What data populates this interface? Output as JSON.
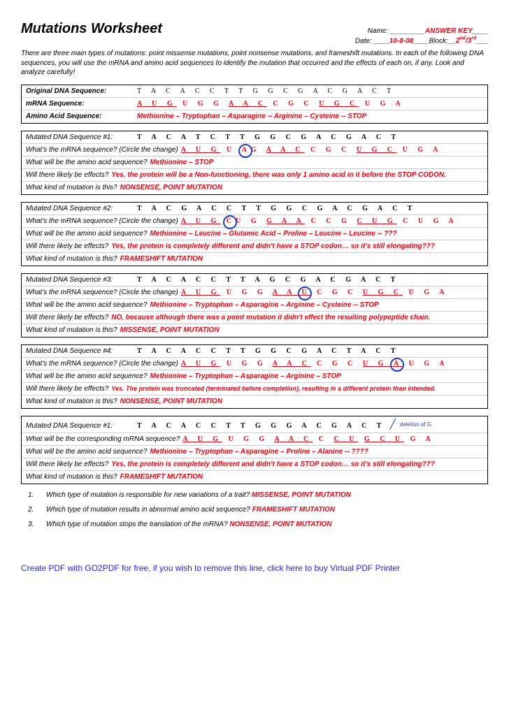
{
  "title": "Mutations Worksheet",
  "meta": {
    "name_label": "Name:",
    "name_value": "ANSWER KEY",
    "date_label": "Date:",
    "date_value": "10-8-08",
    "block_label": "Block:",
    "block_value": "2"
  },
  "intro": "There are three main types of mutations: point missense mutations, point nonsense mutations, and frameshift mutations. In each of the following DNA sequences, you will use the mRNA and amino acid sequences to identify the mutation that occurred and the effects of each on, if any. Look and analyze carefully!",
  "original": {
    "dna_label": "Original DNA Sequence:",
    "dna": "T A C A C C T T G G C G A C G A C T",
    "mrna_label": "mRNA Sequence:",
    "mrna_parts": [
      "A U G",
      " U G G ",
      "A A C",
      " C G C ",
      "U G C",
      " U G A"
    ],
    "aa_label": "Amino Acid Sequence:",
    "aa": "Methionine – Tryptophan – Asparagine -- Arginine – Cysteine -- STOP"
  },
  "mutations": [
    {
      "seq_label": "Mutated DNA Sequence #1:",
      "dna": "T A C A T C T T G G C G A C G A C T",
      "mrna_label": "What's the mRNA sequence? (Circle the change)",
      "mrna_pre": "A U G",
      " mrna_mid1": " U ",
      "circled": "A",
      "mrna_mid2": "G ",
      "mrna_u2": "A A C",
      "mrna_mid3": " C G C ",
      "mrna_u3": "U G C",
      "mrna_post": " U G A",
      "aa_q": "What will be the amino acid sequence?",
      "aa": "Methionine – STOP",
      "eff_q": "Will there likely be effects?",
      "eff": "Yes, the protein will be a Non-functioning, there was only 1 amino acid in it before the STOP CODON.",
      "kind_q": "What kind of mutation is this?",
      "kind": "NONSENSE, POINT MUTATION"
    },
    {
      "seq_label": "Mutated DNA Sequence #2:",
      "dna": "T A C G A C C T T G G C G A C G A C T",
      "mrna_label": "What's the mRNA sequence? (Circle the change)",
      "mrna_pre": "A U G",
      "mrna_mid1": " ",
      "circled": "C",
      "mrna_mid2": "U G ",
      "mrna_u2": "G A A",
      "mrna_mid3": " C C G ",
      "mrna_u3": "C U G",
      "mrna_post": " C U G A",
      "aa_q": "What will be the amino acid sequence?",
      "aa": "Methionine – Leucine – Glutamic Acid – Proline – Leucine – Leucine -- ???",
      "eff_q": "Will there likely be effects?",
      "eff": "Yes, the protein is completely different and didn't have a STOP codon… so it's still elongating???",
      "kind_q": "What kind of mutation is this?",
      "kind": "FRAMESHIFT MUTATION"
    },
    {
      "seq_label": "Mutated DNA Sequence #3:",
      "dna": "T A C A C C T T A G C G A C G A C T",
      "mrna_label": "What's the mRNA sequence? (Circle the change)",
      "mrna_pre": "A U G",
      "mrna_mid1": " U G G ",
      "mrna_u2p": "A A ",
      "circled": "U",
      "mrna_mid2": "",
      "mrna_mid3": " C G C ",
      "mrna_u3": "U G C",
      "mrna_post": " U G A",
      "aa_q": "What will be the amino acid sequence?",
      "aa": "Methionine – Tryptophan – Asparagine – Arginine – Cysteine -- STOP",
      "eff_q": "Will there likely be effects?",
      "eff": "NO, because although there was a point mutation it didn't effect the resulting polypeptide chain.",
      "kind_q": "What kind of mutation is this?",
      "kind": "MISSENSE, POINT MUTATION"
    },
    {
      "seq_label": "Mutated DNA Sequence #4:",
      "dna": "T A C A C C T T G G C G A C T A C T",
      "mrna_label": "What's the mRNA sequence? (Circle the change)",
      "mrna_pre": "A U G",
      "mrna_mid1": " U G G ",
      "mrna_u2": "A A C",
      "mrna_mid3": " C G C ",
      "mrna_u3p": "U G ",
      "circled": "A",
      "mrna_post": " U G A",
      "aa_q": "What will be the amino acid sequence?",
      "aa": "Methionine – Tryptophan – Asparagine – Arginine – STOP",
      "eff_q": "Will there likely be effects?",
      "eff": "Yes. The protein was truncated (terminated before completion), resulting in a different protein than intended.",
      "kind_q": "What kind of mutation is this?",
      "kind": "NONSENSE, POINT MUTATION"
    },
    {
      "seq_label": "Mutated DNA Sequence #1:",
      "dna": "T A C A C C T T G G G A C G A C T",
      "annot": "deletion of G",
      "mrna_label": "What will be the corresponding mRNA sequence?",
      "mrna_pre": "A U G",
      "mrna_mid1": " U G G ",
      "mrna_u2": "A A C",
      "mrna_mid3": " C ",
      "mrna_u3": "C U",
      "mrna_mid4": " ",
      "mrna_u4": "G C U",
      "mrna_post": " G A",
      "aa_q": "What will be the amino acid sequence?",
      "aa": "Methionine – Tryptophan – Asparagine – Proline – Alanine -- ????",
      "eff_q": "Will there likely be effects?",
      "eff": "Yes, the protein is completely different and didn't have a STOP codon… so it's still elongating???",
      "kind_q": "What kind of mutation is this?",
      "kind": "FRAMESHIFT MUTATION"
    }
  ],
  "questions": [
    {
      "n": "1.",
      "q": "Which type of mutation is responsible for new variations of a trait?",
      "a": "MISSENSE, POINT MUTATION"
    },
    {
      "n": "2.",
      "q": "Which type of mutation results in abnormal amino acid sequence?",
      "a": "FRAMESHIFT MUTATION"
    },
    {
      "n": "3.",
      "q": "Which type of mutation stops the translation of the mRNA?",
      "a": "NONSENSE, POINT MUTATION"
    }
  ],
  "footer": "Create PDF with GO2PDF for free, if you wish to remove this line, click here to buy Virtual PDF Printer"
}
